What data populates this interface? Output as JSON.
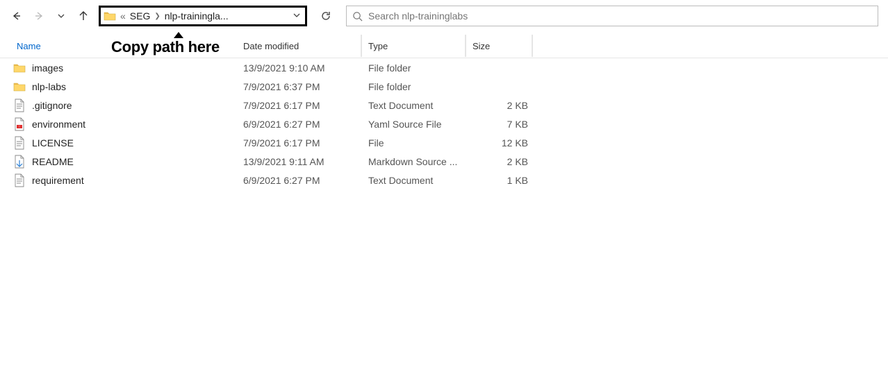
{
  "breadcrumb": {
    "prefix_sep": "«",
    "seg1": "SEG",
    "seg2": "nlp-trainingla..."
  },
  "search": {
    "placeholder": "Search nlp-traininglabs"
  },
  "annotation": "Copy path here",
  "cols": {
    "name": "Name",
    "date": "Date modified",
    "type": "Type",
    "size": "Size"
  },
  "files": [
    {
      "icon": "folder",
      "name": "images",
      "date": "13/9/2021 9:10 AM",
      "type": "File folder",
      "size": ""
    },
    {
      "icon": "folder",
      "name": "nlp-labs",
      "date": "7/9/2021 6:37 PM",
      "type": "File folder",
      "size": ""
    },
    {
      "icon": "txt",
      "name": ".gitignore",
      "date": "7/9/2021 6:17 PM",
      "type": "Text Document",
      "size": "2 KB"
    },
    {
      "icon": "yaml",
      "name": "environment",
      "date": "6/9/2021 6:27 PM",
      "type": "Yaml Source File",
      "size": "7 KB"
    },
    {
      "icon": "file",
      "name": "LICENSE",
      "date": "7/9/2021 6:17 PM",
      "type": "File",
      "size": "12 KB"
    },
    {
      "icon": "md",
      "name": "README",
      "date": "13/9/2021 9:11 AM",
      "type": "Markdown Source ...",
      "size": "2 KB"
    },
    {
      "icon": "txt",
      "name": "requirement",
      "date": "6/9/2021 6:27 PM",
      "type": "Text Document",
      "size": "1 KB"
    }
  ]
}
